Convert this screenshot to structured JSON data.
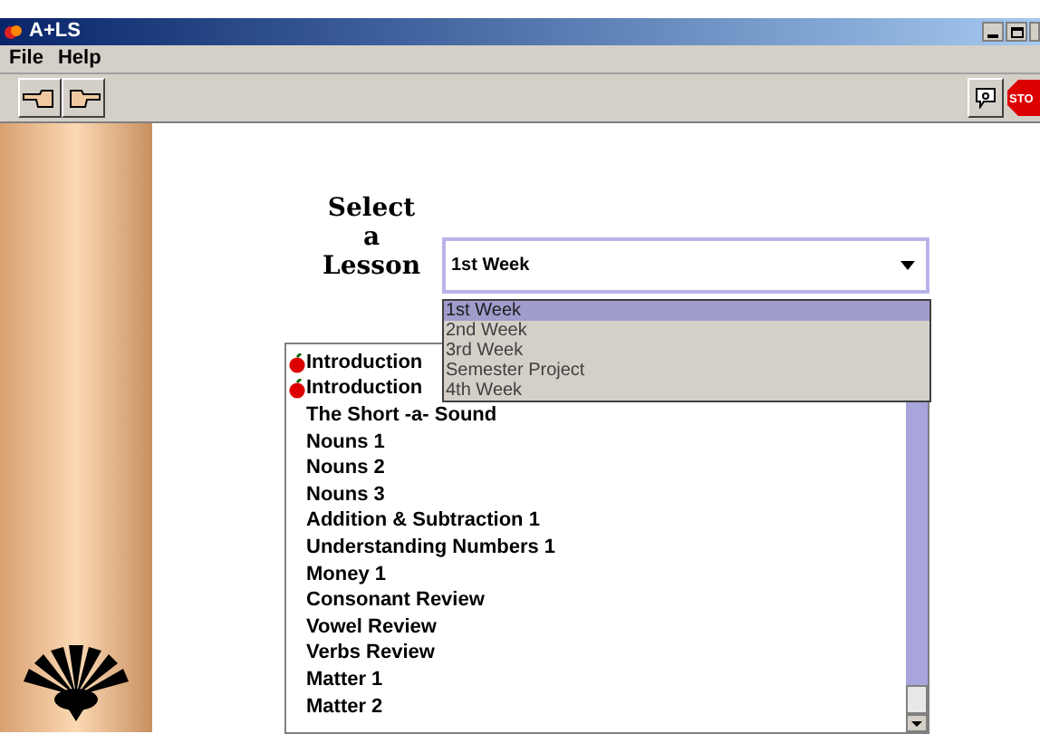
{
  "window": {
    "title": "A+LS"
  },
  "menu": [
    "File",
    "Help"
  ],
  "toolbar": {
    "stop_label": "STO"
  },
  "heading": [
    "Select",
    "a",
    "Lesson"
  ],
  "lesson_select": {
    "value": "1st Week",
    "expanded": true,
    "options": [
      {
        "label": "1st Week",
        "selected": true
      },
      {
        "label": "2nd Week",
        "selected": false
      },
      {
        "label": "3rd Week",
        "selected": false
      },
      {
        "label": "Semester Project",
        "selected": false
      },
      {
        "label": "4th Week",
        "selected": false
      }
    ]
  },
  "lessons": [
    {
      "label": "Introduction",
      "marked": true
    },
    {
      "label": "Introduction",
      "marked": true
    },
    {
      "label": "The Short -a- Sound",
      "marked": false
    },
    {
      "label": "Nouns 1",
      "marked": false
    },
    {
      "label": "Nouns 2",
      "marked": false
    },
    {
      "label": "Nouns 3",
      "marked": false
    },
    {
      "label": "Addition & Subtraction 1",
      "marked": false
    },
    {
      "label": "Understanding Numbers 1",
      "marked": false
    },
    {
      "label": "Money 1",
      "marked": false
    },
    {
      "label": "Consonant Review",
      "marked": false
    },
    {
      "label": "Vowel Review",
      "marked": false
    },
    {
      "label": "Verbs Review",
      "marked": false
    },
    {
      "label": "Matter 1",
      "marked": false
    },
    {
      "label": "Matter 2",
      "marked": false
    }
  ]
}
